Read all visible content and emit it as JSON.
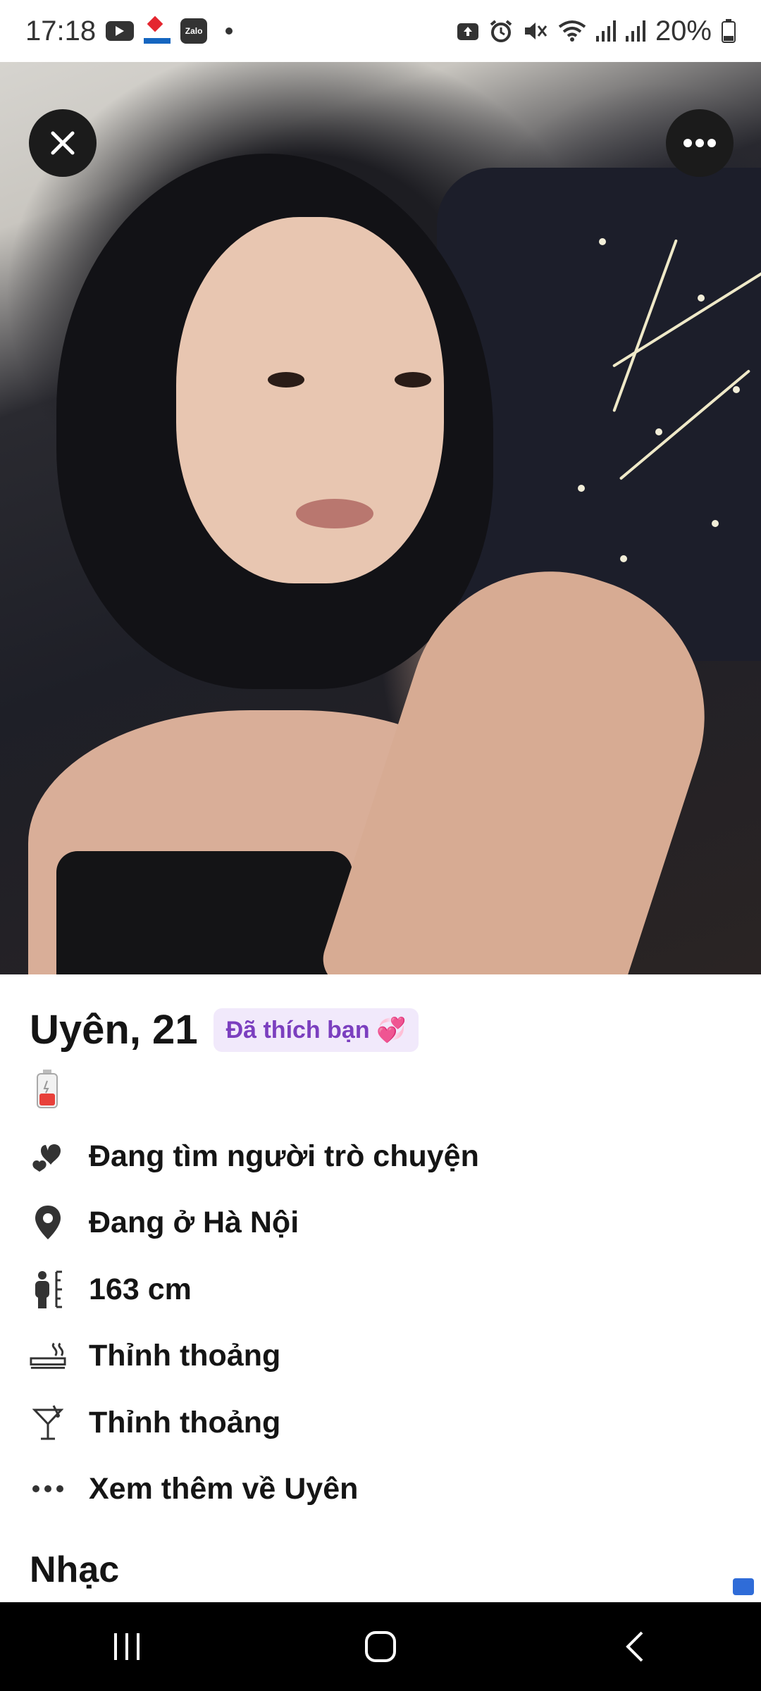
{
  "status_bar": {
    "time": "17:18",
    "left_icons": [
      "youtube-icon",
      "vnpay-icon",
      "zalo-icon",
      "dot-icon"
    ],
    "zalo_label": "Zalo",
    "right_icons": [
      "upload-icon",
      "alarm-icon",
      "mute-icon",
      "wifi-icon",
      "signal-icon",
      "signal-icon"
    ],
    "battery": "20%"
  },
  "profile": {
    "photo_icon_close": "close-icon",
    "photo_icon_more": "more-icon",
    "name_age": "Uyên, 21",
    "liked_badge": "Đã thích bạn 💞",
    "details": [
      {
        "icon": "hearts-icon",
        "text": "Đang tìm người trò chuyện"
      },
      {
        "icon": "location-pin-icon",
        "text": "Đang ở Hà Nội"
      },
      {
        "icon": "height-icon",
        "text": "163 cm"
      },
      {
        "icon": "smoking-icon",
        "text": "Thỉnh thoảng"
      },
      {
        "icon": "cocktail-icon",
        "text": "Thỉnh thoảng"
      },
      {
        "icon": "more-dots-icon",
        "text": "Xem thêm về Uyên"
      }
    ],
    "music_section_title": "Nhạc"
  },
  "nav_bar": {
    "buttons": [
      "recent-apps-icon",
      "home-icon",
      "back-icon"
    ]
  },
  "colors": {
    "badge_bg": "#f1e9fb",
    "badge_text": "#7b3fbf",
    "text_primary": "#151515",
    "nav_bg": "#000000"
  }
}
